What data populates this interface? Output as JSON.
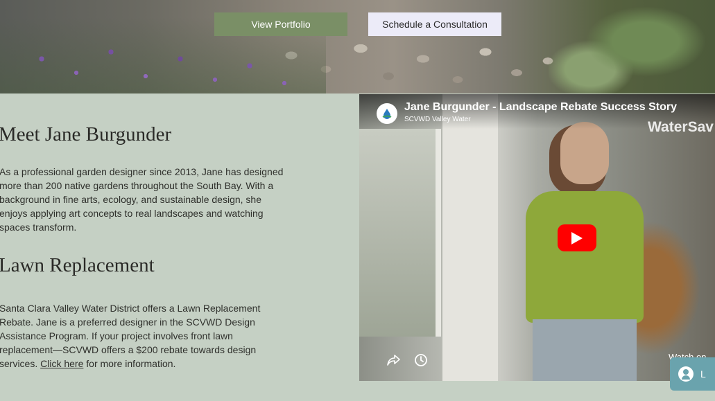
{
  "hero": {
    "portfolio_button": "View Portfolio",
    "consultation_button": "Schedule a Consultation"
  },
  "about": {
    "heading": "Meet Jane Burgunder",
    "bio": "As a professional garden designer since 2013, Jane has designed more than 200 native gardens throughout the South Bay. With a background in fine arts, ecology, and sustainable design, she enjoys applying art concepts to real landscapes and watching spaces transform."
  },
  "lawn": {
    "heading": "Lawn Replacement",
    "body": "Santa Clara Valley Water District offers a Lawn Replacement Rebate. Jane is a preferred designer in the SCVWD Design Assistance Program. If your project involves front lawn replacement—SCVWD offers a $200 rebate towards design services.",
    "link_text": "Click here",
    "after_link": "for more information."
  },
  "video": {
    "title": "Jane Burgunder - Landscape Rebate Success Story",
    "channel": "SCVWD Valley Water",
    "watermark": "WaterSav",
    "watch_on": "Watch on",
    "icons": {
      "share": "share-icon",
      "watch_later": "clock-icon",
      "play": "play-icon"
    }
  },
  "login": {
    "label": "L"
  },
  "colors": {
    "page_bg": "#c5d0c4",
    "portfolio_btn": "#7a8f66",
    "consult_btn": "#ecebf8",
    "youtube_red": "#ff0000",
    "login_pill": "#6aa3ad"
  }
}
